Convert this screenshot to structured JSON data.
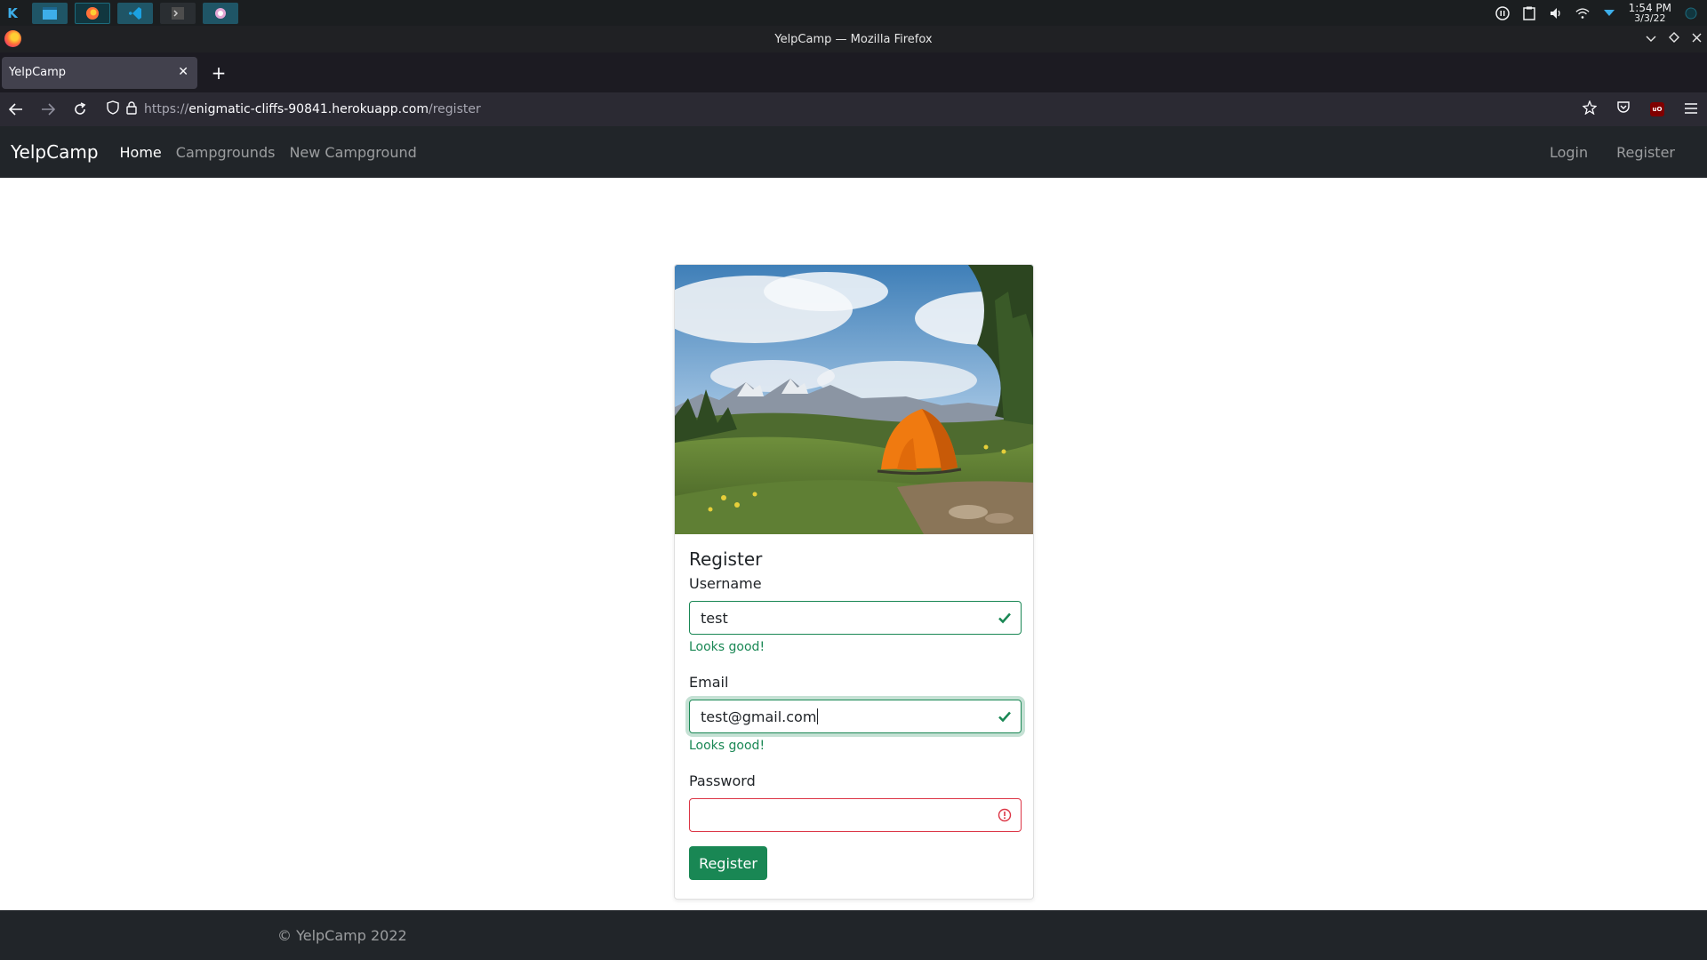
{
  "taskbar": {
    "launcher_icon": "kde-launcher-icon",
    "tasks": [
      "dolphin-icon",
      "firefox-icon",
      "vscode-icon",
      "terminal-icon",
      "app-icon"
    ],
    "clock_time": "1:54 PM",
    "clock_date": "3/3/22"
  },
  "window": {
    "title": "YelpCamp — Mozilla Firefox"
  },
  "browser": {
    "tab_title": "YelpCamp",
    "url_scheme": "https://",
    "url_host": "enigmatic-cliffs-90841.herokuapp.com",
    "url_path": "/register"
  },
  "site_nav": {
    "brand": "YelpCamp",
    "links": [
      "Home",
      "Campgrounds",
      "New Campground"
    ],
    "right_links": [
      "Login",
      "Register"
    ]
  },
  "register_form": {
    "title": "Register",
    "username_label": "Username",
    "username_value": "test",
    "username_feedback": "Looks good!",
    "email_label": "Email",
    "email_value": "test@gmail.com",
    "email_feedback": "Looks good!",
    "password_label": "Password",
    "password_value": "",
    "submit_label": "Register"
  },
  "footer": {
    "text": "© YelpCamp 2022"
  },
  "colors": {
    "success": "#198754",
    "danger": "#dc3545",
    "navbar": "#212529",
    "tent": "#f07a10"
  }
}
